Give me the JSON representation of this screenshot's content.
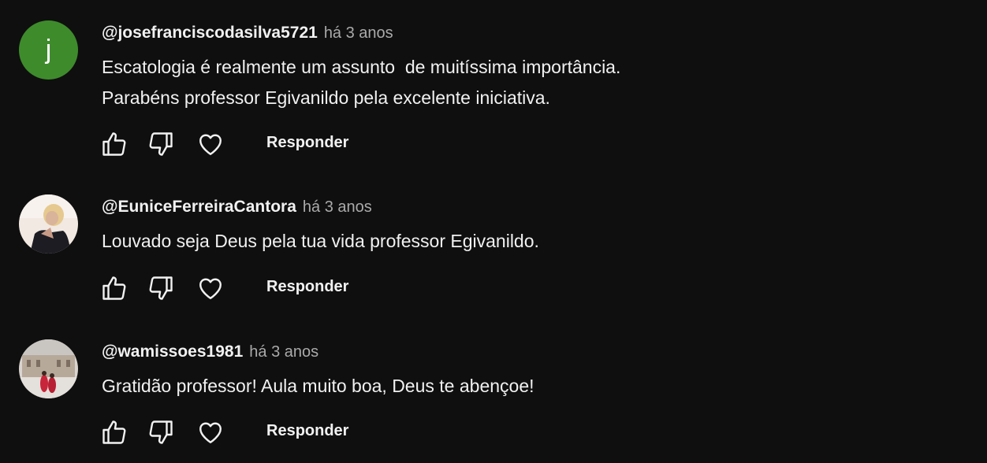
{
  "comments": [
    {
      "avatar_letter": "j",
      "avatar_color": "#3e8b2c",
      "author": "@josefranciscodasilva5721",
      "time": "há 3 anos",
      "lines": [
        "Escatologia é realmente um assunto  de muitíssima importância.",
        "Parabéns professor Egivanildo pela excelente iniciativa."
      ],
      "reply_label": "Responder"
    },
    {
      "avatar_icon": "profile-photo-woman",
      "author": "@EuniceFerreiraCantora",
      "time": "há 3 anos",
      "lines": [
        "Louvado seja Deus pela tua vida professor Egivanildo."
      ],
      "reply_label": "Responder"
    },
    {
      "avatar_icon": "profile-photo-building",
      "author": "@wamissoes1981",
      "time": "há 3 anos",
      "lines": [
        "Gratidão professor! Aula muito boa, Deus te abençoe!"
      ],
      "reply_label": "Responder"
    }
  ],
  "icons": {
    "like": "thumbs-up-icon",
    "dislike": "thumbs-down-icon",
    "heart": "heart-icon"
  },
  "colors": {
    "background": "#0f0f0f",
    "text": "#f1f1f1",
    "muted": "#aaaaaa"
  }
}
